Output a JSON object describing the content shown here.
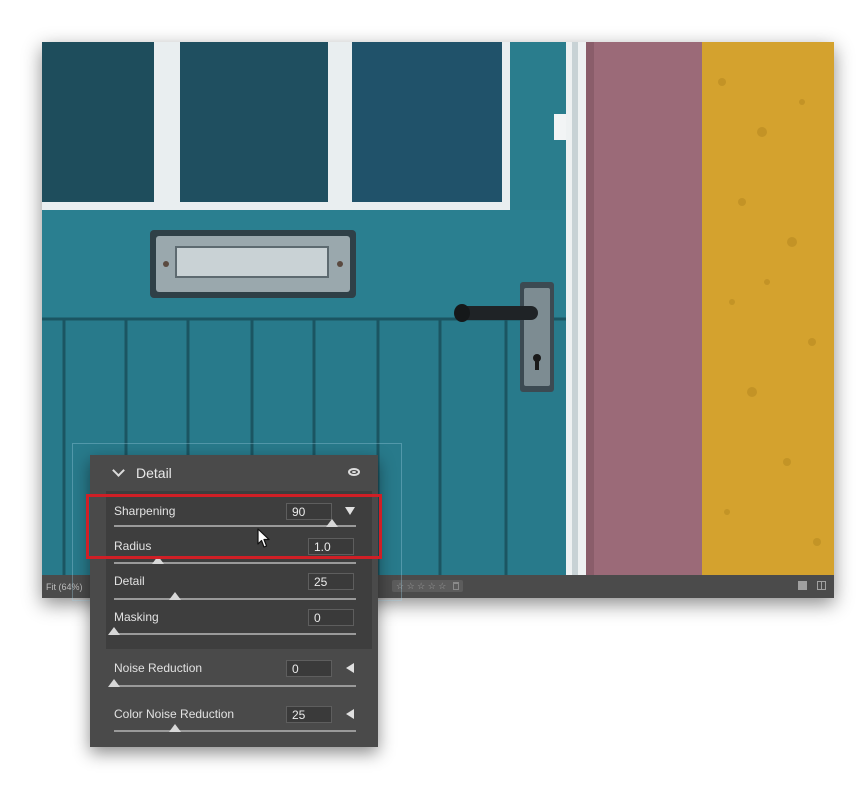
{
  "status_bar": {
    "zoom": "Fit (64%)",
    "rating_stars": "☆ ☆ ☆ ☆ ☆"
  },
  "detail_panel": {
    "title": "Detail",
    "sliders": [
      {
        "label": "Sharpening",
        "value": "90",
        "level": 0.9,
        "range": [
          0,
          150
        ],
        "flyout": "collapse-triangle-down"
      },
      {
        "label": "Radius",
        "value": "1.0",
        "level": 0.18,
        "range": [
          0.5,
          3.0
        ]
      },
      {
        "label": "Detail",
        "value": "25",
        "level": 0.25,
        "range": [
          0,
          100
        ]
      },
      {
        "label": "Masking",
        "value": "0",
        "level": 0.0,
        "range": [
          0,
          100
        ]
      },
      {
        "label": "Noise Reduction",
        "value": "0",
        "level": 0.0,
        "range": [
          0,
          100
        ],
        "flyout": "expand-triangle-left"
      },
      {
        "label": "Color Noise Reduction",
        "value": "25",
        "level": 0.25,
        "range": [
          0,
          100
        ],
        "flyout": "expand-triangle-left"
      }
    ]
  },
  "icons": {
    "collapse": "chevron-down-icon",
    "visibility": "eye-icon",
    "cursor": "mouse-pointer-icon"
  },
  "colors": {
    "highlight": "#d01f26",
    "door": "#2a7a8a",
    "wall_pink": "#9a6a78",
    "wall_yellow": "#d4a22e",
    "panel_bg": "#4a4a4a"
  }
}
